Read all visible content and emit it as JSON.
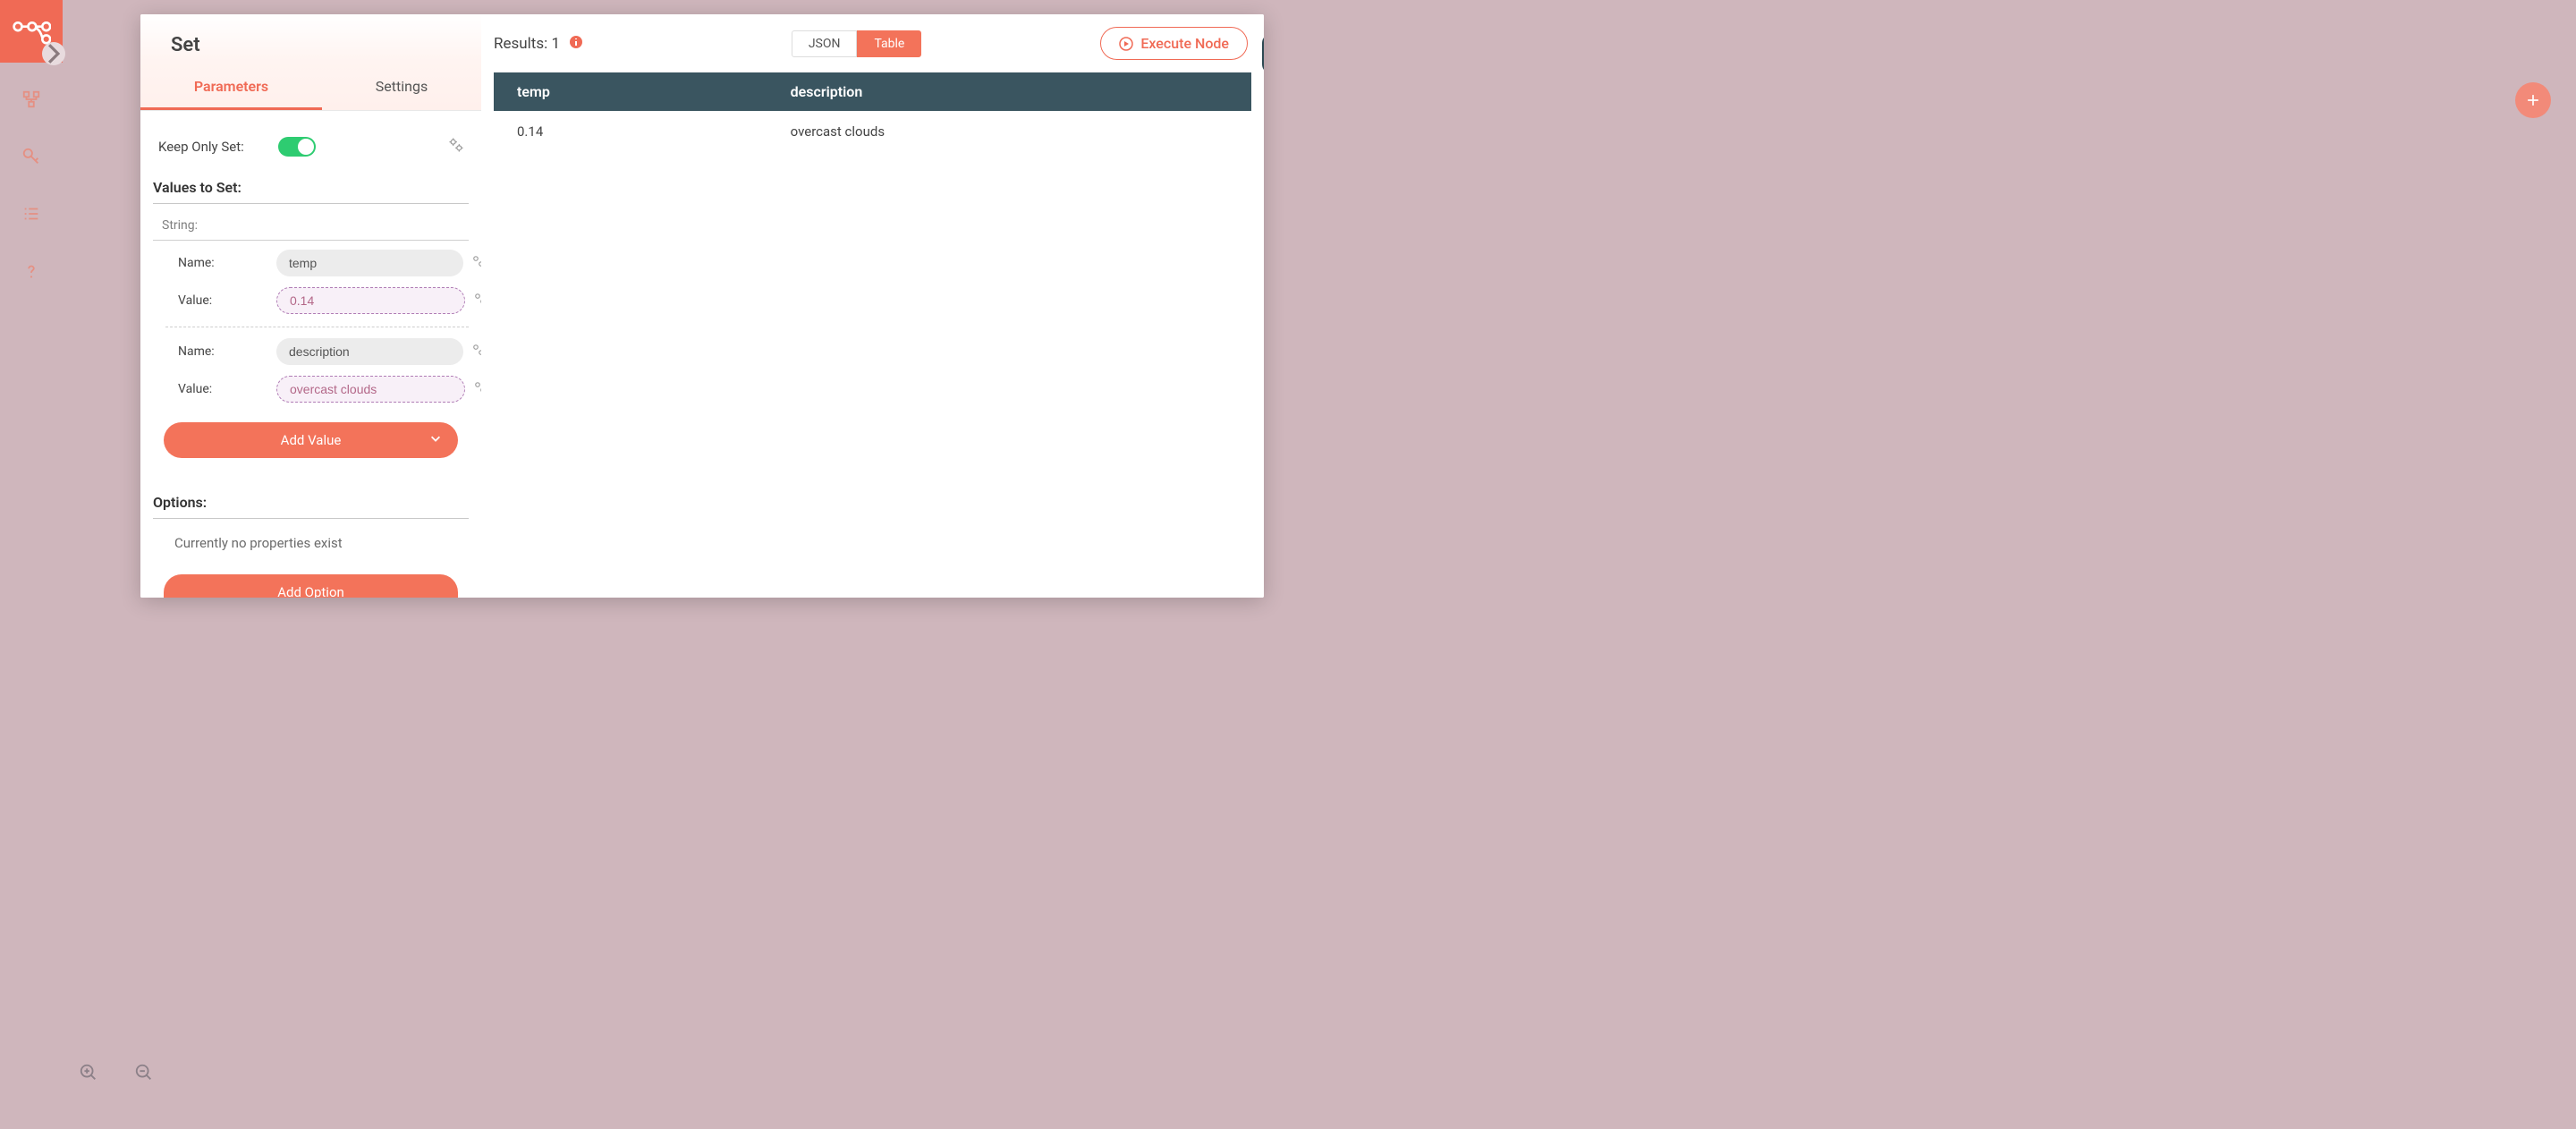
{
  "sidebar": {
    "logo_name": "n8n-logo",
    "icons": [
      "workflows-icon",
      "key-icon",
      "list-icon",
      "help-icon"
    ]
  },
  "floating": {
    "add_label": "+"
  },
  "modal": {
    "title": "Set",
    "tabs": {
      "parameters": "Parameters",
      "settings": "Settings",
      "active": "parameters"
    },
    "keepOnlySet": {
      "label": "Keep Only Set:",
      "value": true
    },
    "valuesToSet": {
      "heading": "Values to Set:",
      "stringHead": "String:",
      "fields": [
        {
          "nameLabel": "Name:",
          "name": "temp",
          "valueLabel": "Value:",
          "value": "0.14"
        },
        {
          "nameLabel": "Name:",
          "name": "description",
          "valueLabel": "Value:",
          "value": "overcast clouds"
        }
      ],
      "addValue": "Add Value"
    },
    "options": {
      "heading": "Options:",
      "empty": "Currently no properties exist",
      "addOption": "Add Option"
    }
  },
  "results": {
    "label": "Results: 1",
    "viewJson": "JSON",
    "viewTable": "Table",
    "activeView": "table",
    "execute": "Execute Node",
    "columns": [
      "temp",
      "description"
    ],
    "rows": [
      {
        "temp": "0.14",
        "description": "overcast clouds"
      }
    ]
  }
}
